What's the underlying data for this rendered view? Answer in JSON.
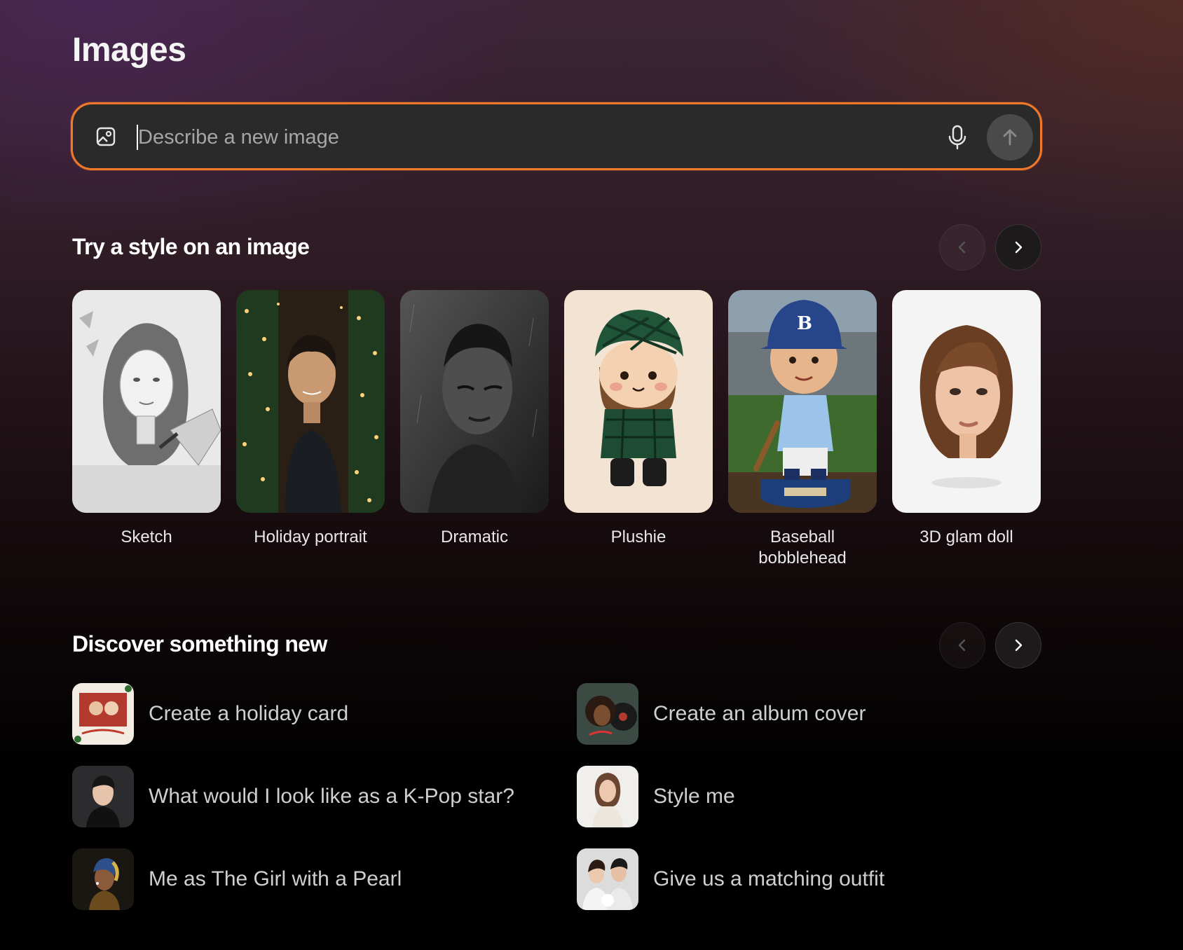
{
  "page": {
    "title": "Images"
  },
  "search": {
    "placeholder": "Describe a new image",
    "value": "",
    "image_icon": "image-upload-icon",
    "mic_icon": "microphone-icon",
    "send_icon": "arrow-up-icon",
    "accent_color": "#f0782a"
  },
  "styles_section": {
    "title": "Try a style on an image",
    "prev_icon": "chevron-left-icon",
    "next_icon": "chevron-right-icon",
    "items": [
      {
        "label": "Sketch"
      },
      {
        "label": "Holiday portrait"
      },
      {
        "label": "Dramatic"
      },
      {
        "label": "Plushie"
      },
      {
        "label": "Baseball bobblehead"
      },
      {
        "label": "3D glam doll"
      }
    ]
  },
  "discover_section": {
    "title": "Discover something new",
    "prev_icon": "chevron-left-icon",
    "next_icon": "chevron-right-icon",
    "items": [
      {
        "label": "Create a holiday card"
      },
      {
        "label": "Create an album cover"
      },
      {
        "label": "What would I look like as a K-Pop star?"
      },
      {
        "label": "Style me"
      },
      {
        "label": "Me as The Girl with a Pearl"
      },
      {
        "label": "Give us a matching outfit"
      }
    ]
  }
}
